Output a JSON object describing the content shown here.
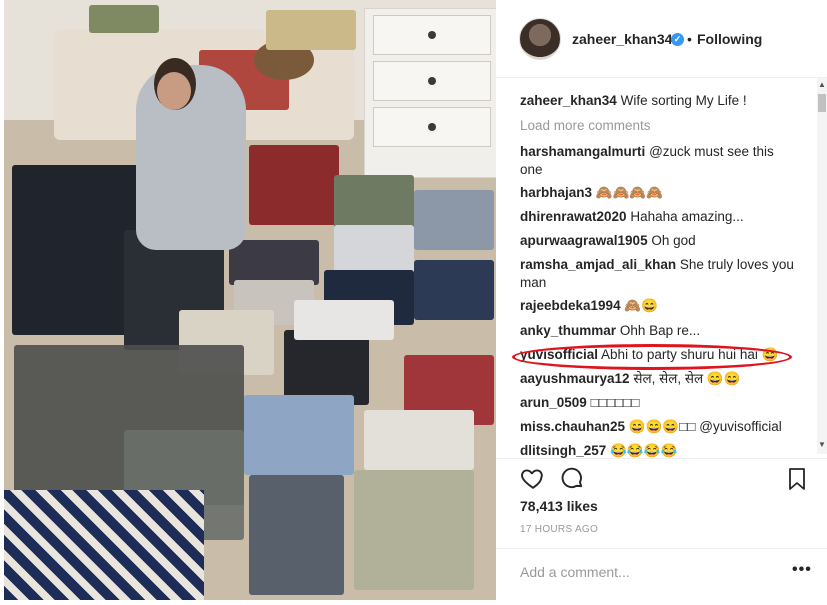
{
  "post": {
    "author": "zaheer_khan34",
    "separator": "•",
    "follow_status": "Following",
    "verified_mark": "✓",
    "photo_icon": "photo-of-clothes-sorting"
  },
  "caption": {
    "username": "zaheer_khan34",
    "text": "Wife sorting My Life !"
  },
  "load_more": "Load more comments",
  "comments": [
    {
      "username": "harshamangalmurti",
      "text": "@zuck must see this one"
    },
    {
      "username": "harbhajan3",
      "text": "🙈🙈🙈🙈"
    },
    {
      "username": "dhirenrawat2020",
      "text": "Hahaha amazing..."
    },
    {
      "username": "apurwaagrawal1905",
      "text": "Oh god"
    },
    {
      "username": "ramsha_amjad_ali_khan",
      "text": "She truly loves you man"
    },
    {
      "username": "rajeebdeka1994",
      "text": "🙈😄"
    },
    {
      "username": "anky_thummar",
      "text": "Ohh Bap re..."
    },
    {
      "username": "yuvisofficial",
      "text": "Abhi to party shuru hui hai 😄"
    },
    {
      "username": "aayushmaurya12",
      "text": "सेल, सेल, सेल 😄😄"
    },
    {
      "username": "arun_0509",
      "text": "□□□□□□"
    },
    {
      "username": "miss.chauhan25",
      "text": "😄😄😄□□ @yuvisofficial"
    },
    {
      "username": "dlitsingh_257",
      "text": "😂😂😂😂"
    }
  ],
  "likes": "78,413 likes",
  "timestamp": "17 HOURS AGO",
  "add_comment_placeholder": "Add a comment...",
  "more_options": "•••",
  "colors": {
    "highlight_circle": "#e0141e",
    "verified_blue": "#3897f0"
  }
}
